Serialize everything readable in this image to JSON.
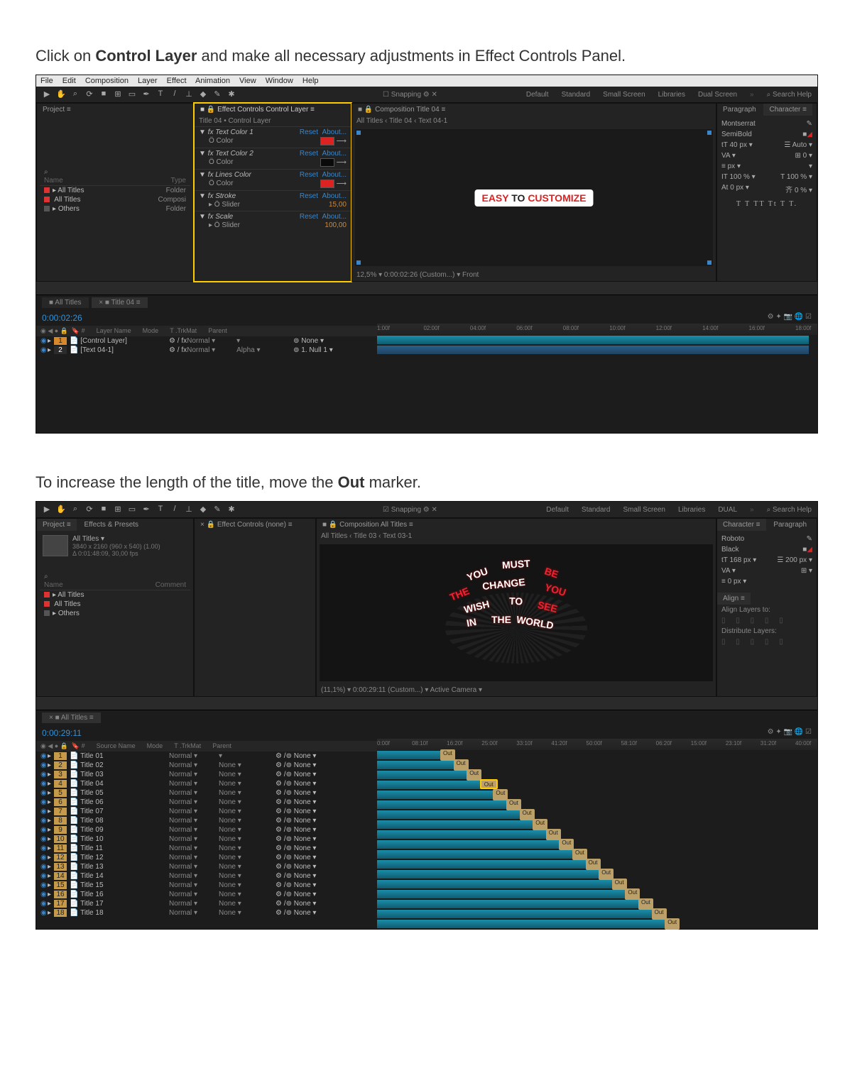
{
  "instructions": {
    "line1_a": "Click on ",
    "line1_b": "Control Layer",
    "line1_c": " and make all necessary adjustments in Effect Controls Panel.",
    "line2_a": "To increase the length of the title, move the ",
    "line2_b": "Out",
    "line2_c": " marker."
  },
  "menu": [
    "File",
    "Edit",
    "Composition",
    "Layer",
    "Effect",
    "Animation",
    "View",
    "Window",
    "Help"
  ],
  "toolbar_snapping": "Snapping",
  "workspaces": [
    "Default",
    "Standard",
    "Small Screen",
    "Libraries",
    "Dual Screen",
    "DUAL"
  ],
  "search_placeholder": "Search Help",
  "shot1": {
    "project_tab": "Project ≡",
    "project_items": [
      {
        "name": "All Titles",
        "type": "Folder"
      },
      {
        "name": "All Titles",
        "type": "Composi"
      },
      {
        "name": "Others",
        "type": "Folder"
      }
    ],
    "project_header_name": "Name",
    "project_header_type": "Type",
    "effects_tab": "Effect Controls Control Layer ≡",
    "effects_sub": "Title 04 • Control Layer",
    "fx": [
      {
        "grp": "fx Text Color 1",
        "rows": [
          {
            "k": "Ö Color",
            "v": "red"
          }
        ],
        "reset": "Reset",
        "about": "About..."
      },
      {
        "grp": "fx Text Color 2",
        "rows": [
          {
            "k": "Ö Color",
            "v": "black"
          }
        ],
        "reset": "Reset",
        "about": "About..."
      },
      {
        "grp": "fx Lines Color",
        "rows": [
          {
            "k": "Ö Color",
            "v": "red"
          }
        ],
        "reset": "Reset",
        "about": "About..."
      },
      {
        "grp": "fx Stroke",
        "rows": [
          {
            "k": "▸ Ö Slider",
            "v": "15,00"
          }
        ],
        "reset": "Reset",
        "about": "About..."
      },
      {
        "grp": "fx Scale",
        "rows": [
          {
            "k": "▸ Ö Slider",
            "v": "100,00"
          }
        ],
        "reset": "Reset",
        "about": "About..."
      }
    ],
    "comp_tab": "Composition Title 04 ≡",
    "comp_breadcrumb": "All Titles  ‹  Title 04  ‹  Text 04-1",
    "comp_text_a": "EASY",
    "comp_text_b": "TO ",
    "comp_text_c": "CUSTOMIZE",
    "comp_footer": "12,5%  ▾  0:00:02:26  (Custom...)  ▾  Front",
    "char_tab1": "Paragraph",
    "char_tab2": "Character ≡",
    "char_font": "Montserrat",
    "char_weight": "SemiBold",
    "char_size": "40 px",
    "char_leading": "Auto",
    "char_tracking": "0",
    "char_kerning": "0 px",
    "char_ht": "100 %",
    "char_wd": "100 %",
    "char_baseline": "0 px",
    "char_scale": "0 %",
    "char_styles": "T  T  TT Tt  T  T.",
    "tl_tab1": "All Titles",
    "tl_tab2": "Title 04 ≡",
    "tl_time": "0:00:02:26",
    "tl_marks": [
      "1:00f",
      "02:00f",
      "04:00f",
      "06:00f",
      "08:00f",
      "10:00f",
      "12:00f",
      "14:00f",
      "16:00f",
      "18:00f"
    ],
    "tl_cols": [
      "Layer Name",
      "Mode",
      "T .TrkMat",
      "Parent"
    ],
    "tl_layers": [
      {
        "idx": "1",
        "name": "[Control Layer]",
        "mode": "Normal",
        "trk": "",
        "parent": "None",
        "focus": true,
        "bar": "cyan",
        "barw": "98%"
      },
      {
        "idx": "2",
        "name": "[Text 04-1]",
        "mode": "Normal",
        "trk": "Alpha",
        "parent": "1. Null 1",
        "bar": "blue",
        "barw": "98%"
      }
    ]
  },
  "shot2": {
    "project_tab": "Project ≡",
    "presets_tab": "Effects & Presets",
    "proj_title": "All Titles ▾",
    "proj_meta1": "3840 x 2160 (960 x 540) (1.00)",
    "proj_meta2": "Δ 0:01:48:09, 30,00 fps",
    "project_items": [
      {
        "name": "All Titles",
        "type": ""
      },
      {
        "name": "All Titles",
        "type": ""
      },
      {
        "name": "Others",
        "type": ""
      }
    ],
    "project_header_name": "Name",
    "project_header_comment": "Comment",
    "effects_tab": "Effect Controls (none) ≡",
    "comp_tab": "Composition All Titles ≡",
    "comp_breadcrumb": "All Titles  ‹  Title 03  ‹  Text 03-1",
    "curve_words": [
      "YOU",
      "MUST",
      "BE",
      "THE",
      "CHANGE",
      "YOU",
      "WISH",
      "TO",
      "SEE",
      "IN",
      "THE",
      "WORLD"
    ],
    "comp_footer": "(11,1%)  ▾  0:00:29:11  (Custom...)  ▾  Active Camera  ▾",
    "char_tab1": "Character ≡",
    "char_tab2": "Paragraph",
    "char_font": "Roboto",
    "char_weight": "Black",
    "char_size": "168 px",
    "char_leading": "200 px",
    "char_other": "0 px",
    "align_tab": "Align ≡",
    "align_line": "Align Layers to:",
    "dist_line": "Distribute Layers:",
    "tl_tab": "All Titles ≡",
    "tl_time": "0:00:29:11",
    "tl_marks": [
      "0:00f",
      "08:10f",
      "16:20f",
      "25:00f",
      "33:10f",
      "41:20f",
      "50:00f",
      "58:10f",
      "06:20f",
      "15:00f",
      "23:10f",
      "31:20f",
      "40:00f"
    ],
    "tl_cols": [
      "Source Name",
      "Mode",
      "T .TrkMat",
      "Parent"
    ],
    "out_labels": {
      "out": "Out"
    },
    "tl_layers": [
      {
        "idx": "1",
        "name": "Title 01",
        "mode": "Normal",
        "trk": "",
        "parent": "None",
        "barw": "15%",
        "out": "15%"
      },
      {
        "idx": "2",
        "name": "Title 02",
        "mode": "Normal",
        "trk": "None",
        "parent": "None",
        "barw": "18%",
        "out": "18%"
      },
      {
        "idx": "3",
        "name": "Title 03",
        "mode": "Normal",
        "trk": "None",
        "parent": "None",
        "barw": "21%",
        "out": "21%"
      },
      {
        "idx": "4",
        "name": "Title 04",
        "mode": "Normal",
        "trk": "None",
        "parent": "None",
        "barw": "24%",
        "out": "24%",
        "hl": true
      },
      {
        "idx": "5",
        "name": "Title 05",
        "mode": "Normal",
        "trk": "None",
        "parent": "None",
        "barw": "27%",
        "out": "27%"
      },
      {
        "idx": "6",
        "name": "Title 06",
        "mode": "Normal",
        "trk": "None",
        "parent": "None",
        "barw": "30%",
        "out": "30%"
      },
      {
        "idx": "7",
        "name": "Title 07",
        "mode": "Normal",
        "trk": "None",
        "parent": "None",
        "barw": "33%",
        "out": "33%"
      },
      {
        "idx": "8",
        "name": "Title 08",
        "mode": "Normal",
        "trk": "None",
        "parent": "None",
        "barw": "36%",
        "out": "36%"
      },
      {
        "idx": "9",
        "name": "Title 09",
        "mode": "Normal",
        "trk": "None",
        "parent": "None",
        "barw": "39%",
        "out": "39%"
      },
      {
        "idx": "10",
        "name": "Title 10",
        "mode": "Normal",
        "trk": "None",
        "parent": "None",
        "barw": "42%",
        "out": "42%"
      },
      {
        "idx": "11",
        "name": "Title 11",
        "mode": "Normal",
        "trk": "None",
        "parent": "None",
        "barw": "45%",
        "out": "45%"
      },
      {
        "idx": "12",
        "name": "Title 12",
        "mode": "Normal",
        "trk": "None",
        "parent": "None",
        "barw": "48%",
        "out": "48%"
      },
      {
        "idx": "13",
        "name": "Title 13",
        "mode": "Normal",
        "trk": "None",
        "parent": "None",
        "barw": "51%",
        "out": "51%"
      },
      {
        "idx": "14",
        "name": "Title 14",
        "mode": "Normal",
        "trk": "None",
        "parent": "None",
        "barw": "54%",
        "out": "54%"
      },
      {
        "idx": "15",
        "name": "Title 15",
        "mode": "Normal",
        "trk": "None",
        "parent": "None",
        "barw": "57%",
        "out": "57%"
      },
      {
        "idx": "16",
        "name": "Title 16",
        "mode": "Normal",
        "trk": "None",
        "parent": "None",
        "barw": "60%",
        "out": "60%"
      },
      {
        "idx": "17",
        "name": "Title 17",
        "mode": "Normal",
        "trk": "None",
        "parent": "None",
        "barw": "63%",
        "out": "63%"
      },
      {
        "idx": "18",
        "name": "Title 18",
        "mode": "Normal",
        "trk": "None",
        "parent": "None",
        "barw": "66%",
        "out": "66%"
      }
    ]
  }
}
